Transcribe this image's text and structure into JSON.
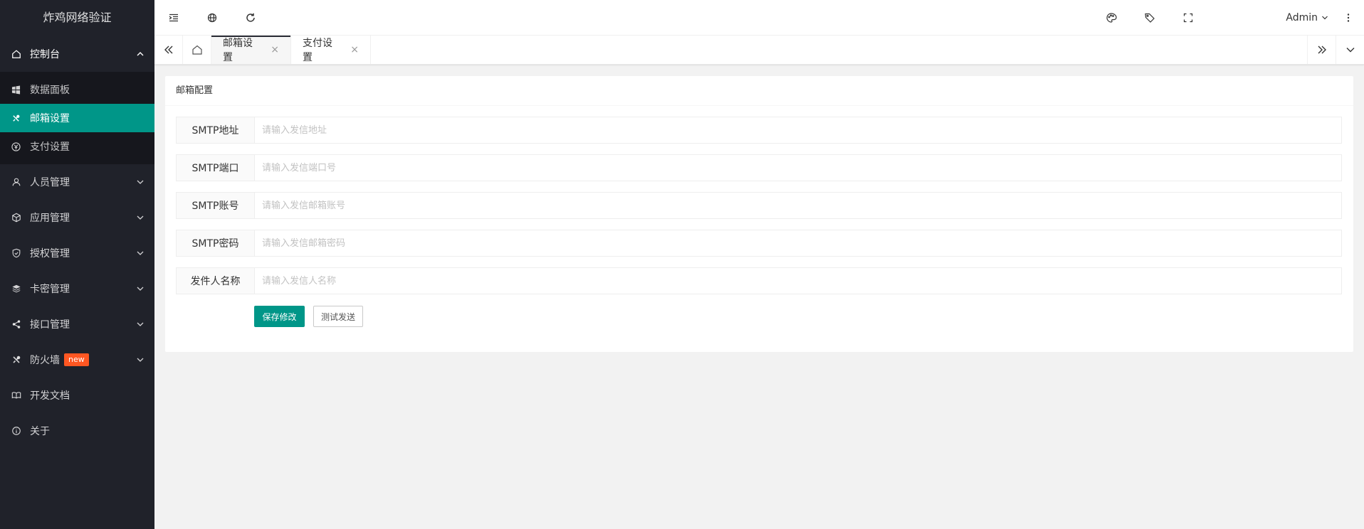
{
  "app": {
    "title": "炸鸡网络验证"
  },
  "sidebar": {
    "console": {
      "label": "控制台",
      "icon": "home-icon"
    },
    "console_items": [
      {
        "label": "数据面板",
        "icon": "windows-icon"
      },
      {
        "label": "邮箱设置",
        "icon": "tools-icon",
        "active": true
      },
      {
        "label": "支付设置",
        "icon": "yen-icon"
      }
    ],
    "groups": [
      {
        "label": "人员管理",
        "icon": "user-icon"
      },
      {
        "label": "应用管理",
        "icon": "cube-icon"
      },
      {
        "label": "授权管理",
        "icon": "shield-icon"
      },
      {
        "label": "卡密管理",
        "icon": "layers-icon"
      },
      {
        "label": "接口管理",
        "icon": "share-icon"
      }
    ],
    "firewall": {
      "label": "防火墙",
      "badge": "new",
      "icon": "tools-icon"
    },
    "docs": {
      "label": "开发文档",
      "icon": "book-icon"
    },
    "about": {
      "label": "关于",
      "icon": "info-icon"
    }
  },
  "header": {
    "user": "Admin"
  },
  "tabs": [
    {
      "label": "邮箱设置",
      "close": "×",
      "active": true
    },
    {
      "label": "支付设置",
      "close": "×",
      "active": false
    }
  ],
  "card": {
    "title": "邮箱配置",
    "fields": [
      {
        "label": "SMTP地址",
        "placeholder": "请输入发信地址",
        "value": ""
      },
      {
        "label": "SMTP端口",
        "placeholder": "请输入发信端口号",
        "value": ""
      },
      {
        "label": "SMTP账号",
        "placeholder": "请输入发信邮箱账号",
        "value": ""
      },
      {
        "label": "SMTP密码",
        "placeholder": "请输入发信邮箱密码",
        "value": ""
      },
      {
        "label": "发件人名称",
        "placeholder": "请输入发信人名称",
        "value": ""
      }
    ],
    "save_label": "保存修改",
    "test_label": "测试发送"
  },
  "colors": {
    "sidebar_bg": "#20222a",
    "accent": "#009688",
    "badge": "#ff5722"
  }
}
